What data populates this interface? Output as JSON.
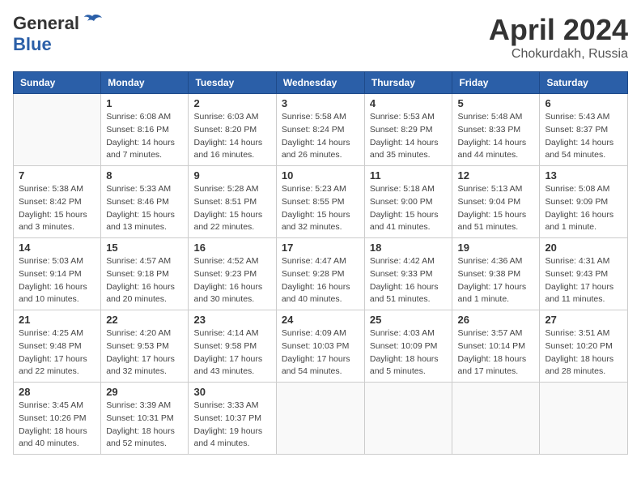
{
  "header": {
    "logo": {
      "general": "General",
      "blue": "Blue"
    },
    "title": "April 2024",
    "location": "Chokurdakh, Russia"
  },
  "calendar": {
    "weekdays": [
      "Sunday",
      "Monday",
      "Tuesday",
      "Wednesday",
      "Thursday",
      "Friday",
      "Saturday"
    ],
    "weeks": [
      [
        {
          "day": "",
          "info": ""
        },
        {
          "day": "1",
          "info": "Sunrise: 6:08 AM\nSunset: 8:16 PM\nDaylight: 14 hours\nand 7 minutes."
        },
        {
          "day": "2",
          "info": "Sunrise: 6:03 AM\nSunset: 8:20 PM\nDaylight: 14 hours\nand 16 minutes."
        },
        {
          "day": "3",
          "info": "Sunrise: 5:58 AM\nSunset: 8:24 PM\nDaylight: 14 hours\nand 26 minutes."
        },
        {
          "day": "4",
          "info": "Sunrise: 5:53 AM\nSunset: 8:29 PM\nDaylight: 14 hours\nand 35 minutes."
        },
        {
          "day": "5",
          "info": "Sunrise: 5:48 AM\nSunset: 8:33 PM\nDaylight: 14 hours\nand 44 minutes."
        },
        {
          "day": "6",
          "info": "Sunrise: 5:43 AM\nSunset: 8:37 PM\nDaylight: 14 hours\nand 54 minutes."
        }
      ],
      [
        {
          "day": "7",
          "info": "Sunrise: 5:38 AM\nSunset: 8:42 PM\nDaylight: 15 hours\nand 3 minutes."
        },
        {
          "day": "8",
          "info": "Sunrise: 5:33 AM\nSunset: 8:46 PM\nDaylight: 15 hours\nand 13 minutes."
        },
        {
          "day": "9",
          "info": "Sunrise: 5:28 AM\nSunset: 8:51 PM\nDaylight: 15 hours\nand 22 minutes."
        },
        {
          "day": "10",
          "info": "Sunrise: 5:23 AM\nSunset: 8:55 PM\nDaylight: 15 hours\nand 32 minutes."
        },
        {
          "day": "11",
          "info": "Sunrise: 5:18 AM\nSunset: 9:00 PM\nDaylight: 15 hours\nand 41 minutes."
        },
        {
          "day": "12",
          "info": "Sunrise: 5:13 AM\nSunset: 9:04 PM\nDaylight: 15 hours\nand 51 minutes."
        },
        {
          "day": "13",
          "info": "Sunrise: 5:08 AM\nSunset: 9:09 PM\nDaylight: 16 hours\nand 1 minute."
        }
      ],
      [
        {
          "day": "14",
          "info": "Sunrise: 5:03 AM\nSunset: 9:14 PM\nDaylight: 16 hours\nand 10 minutes."
        },
        {
          "day": "15",
          "info": "Sunrise: 4:57 AM\nSunset: 9:18 PM\nDaylight: 16 hours\nand 20 minutes."
        },
        {
          "day": "16",
          "info": "Sunrise: 4:52 AM\nSunset: 9:23 PM\nDaylight: 16 hours\nand 30 minutes."
        },
        {
          "day": "17",
          "info": "Sunrise: 4:47 AM\nSunset: 9:28 PM\nDaylight: 16 hours\nand 40 minutes."
        },
        {
          "day": "18",
          "info": "Sunrise: 4:42 AM\nSunset: 9:33 PM\nDaylight: 16 hours\nand 51 minutes."
        },
        {
          "day": "19",
          "info": "Sunrise: 4:36 AM\nSunset: 9:38 PM\nDaylight: 17 hours\nand 1 minute."
        },
        {
          "day": "20",
          "info": "Sunrise: 4:31 AM\nSunset: 9:43 PM\nDaylight: 17 hours\nand 11 minutes."
        }
      ],
      [
        {
          "day": "21",
          "info": "Sunrise: 4:25 AM\nSunset: 9:48 PM\nDaylight: 17 hours\nand 22 minutes."
        },
        {
          "day": "22",
          "info": "Sunrise: 4:20 AM\nSunset: 9:53 PM\nDaylight: 17 hours\nand 32 minutes."
        },
        {
          "day": "23",
          "info": "Sunrise: 4:14 AM\nSunset: 9:58 PM\nDaylight: 17 hours\nand 43 minutes."
        },
        {
          "day": "24",
          "info": "Sunrise: 4:09 AM\nSunset: 10:03 PM\nDaylight: 17 hours\nand 54 minutes."
        },
        {
          "day": "25",
          "info": "Sunrise: 4:03 AM\nSunset: 10:09 PM\nDaylight: 18 hours\nand 5 minutes."
        },
        {
          "day": "26",
          "info": "Sunrise: 3:57 AM\nSunset: 10:14 PM\nDaylight: 18 hours\nand 17 minutes."
        },
        {
          "day": "27",
          "info": "Sunrise: 3:51 AM\nSunset: 10:20 PM\nDaylight: 18 hours\nand 28 minutes."
        }
      ],
      [
        {
          "day": "28",
          "info": "Sunrise: 3:45 AM\nSunset: 10:26 PM\nDaylight: 18 hours\nand 40 minutes."
        },
        {
          "day": "29",
          "info": "Sunrise: 3:39 AM\nSunset: 10:31 PM\nDaylight: 18 hours\nand 52 minutes."
        },
        {
          "day": "30",
          "info": "Sunrise: 3:33 AM\nSunset: 10:37 PM\nDaylight: 19 hours\nand 4 minutes."
        },
        {
          "day": "",
          "info": ""
        },
        {
          "day": "",
          "info": ""
        },
        {
          "day": "",
          "info": ""
        },
        {
          "day": "",
          "info": ""
        }
      ]
    ]
  }
}
